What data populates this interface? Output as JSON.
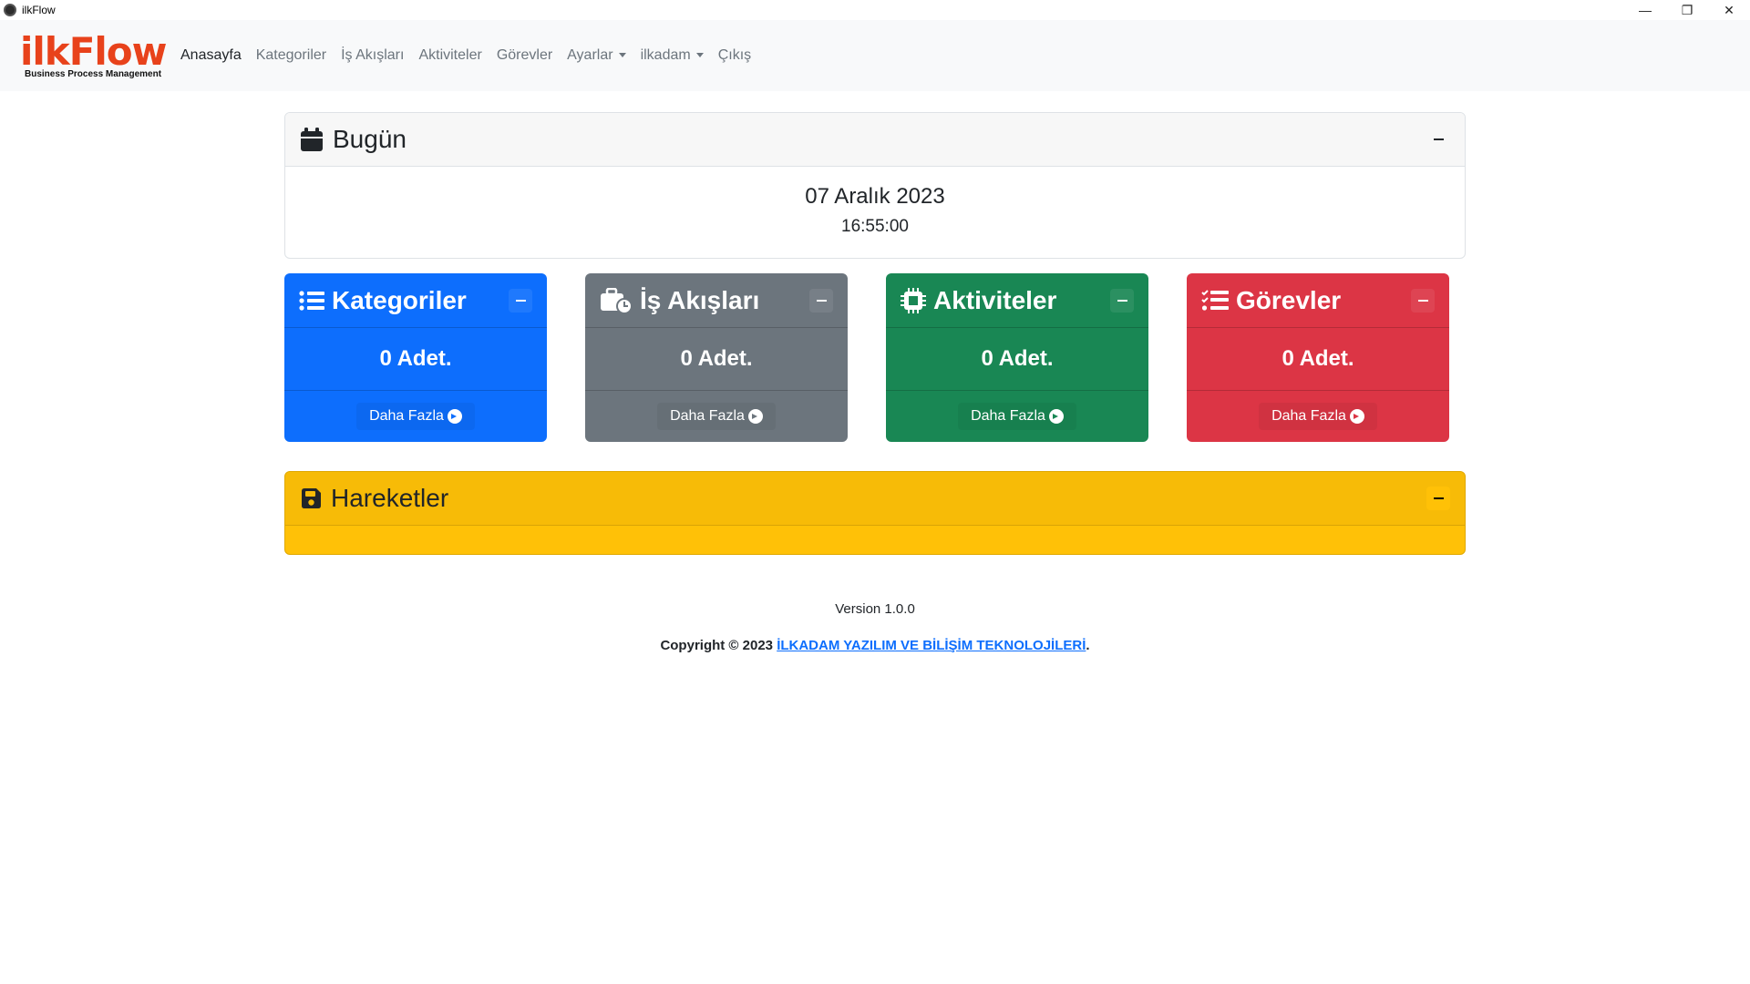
{
  "window": {
    "title": "ilkFlow"
  },
  "brand": {
    "logo": "ilkFlow",
    "subtitle": "Business Process Management"
  },
  "nav": {
    "items": [
      {
        "label": "Anasayfa"
      },
      {
        "label": "Kategoriler"
      },
      {
        "label": "İş Akışları"
      },
      {
        "label": "Aktiviteler"
      },
      {
        "label": "Görevler"
      },
      {
        "label": "Ayarlar"
      },
      {
        "label": "ilkadam"
      },
      {
        "label": "Çıkış"
      }
    ]
  },
  "today": {
    "title": "Bugün",
    "date": "07 Aralık 2023",
    "time": "16:55:00"
  },
  "stats": [
    {
      "title": "Kategoriler",
      "count": "0 Adet.",
      "more": "Daha Fazla",
      "color": "#0d6efd",
      "icon": "list-icon"
    },
    {
      "title": "İş Akışları",
      "count": "0 Adet.",
      "more": "Daha Fazla",
      "color": "#6c757d",
      "icon": "briefcase-clock-icon"
    },
    {
      "title": "Aktiviteler",
      "count": "0 Adet.",
      "more": "Daha Fazla",
      "color": "#198754",
      "icon": "microchip-icon"
    },
    {
      "title": "Görevler",
      "count": "0 Adet.",
      "more": "Daha Fazla",
      "color": "#dc3545",
      "icon": "list-check-icon"
    }
  ],
  "moves": {
    "title": "Hareketler",
    "color": "#ffc107"
  },
  "footer": {
    "version": "Version 1.0.0",
    "copyright_prefix": "Copyright © 2023 ",
    "company": "İLKADAM YAZILIM VE BİLİŞİM TEKNOLOJİLERİ",
    "suffix": "."
  }
}
